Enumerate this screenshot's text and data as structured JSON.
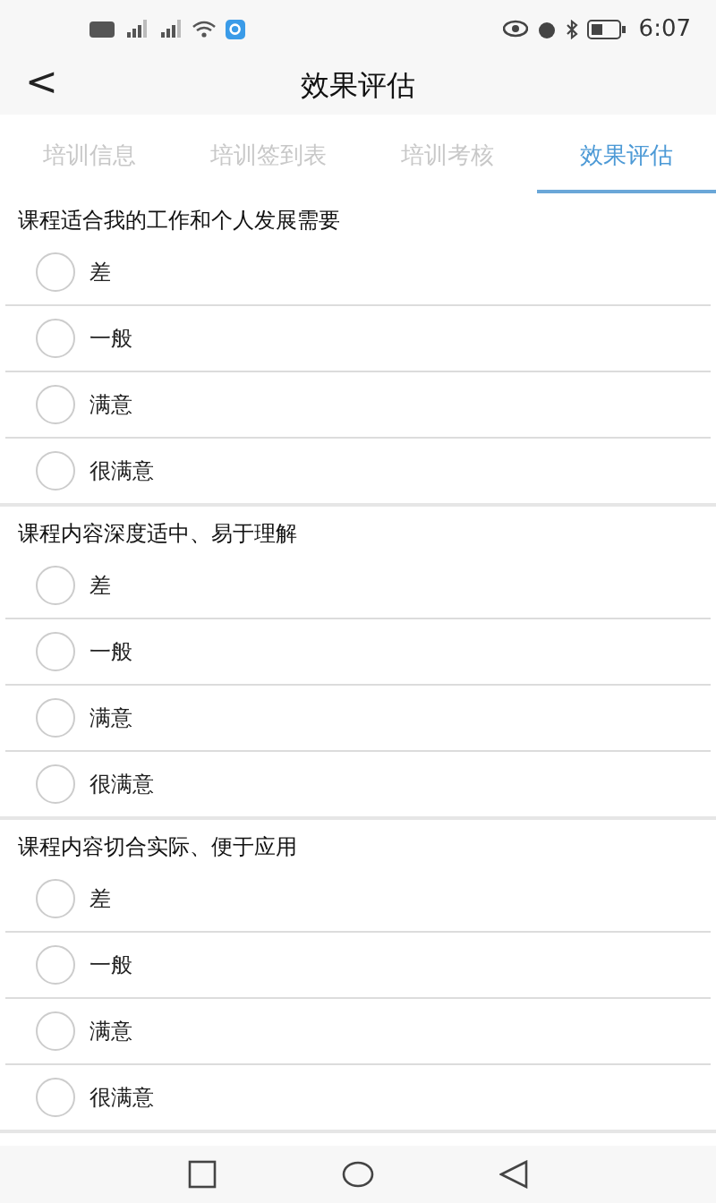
{
  "status_bar": {
    "time": "6:07"
  },
  "header": {
    "back": "<",
    "title": "效果评估"
  },
  "tabs": [
    {
      "label": "培训信息",
      "selected": false
    },
    {
      "label": "培训签到表",
      "selected": false
    },
    {
      "label": "培训考核",
      "selected": false
    },
    {
      "label": "效果评估",
      "selected": true
    }
  ],
  "questions": [
    {
      "title": "课程适合我的工作和个人发展需要",
      "options": [
        {
          "label": "差",
          "selected": false
        },
        {
          "label": "一般",
          "selected": false
        },
        {
          "label": "满意",
          "selected": false
        },
        {
          "label": "很满意",
          "selected": false
        }
      ]
    },
    {
      "title": "课程内容深度适中、易于理解",
      "options": [
        {
          "label": "差",
          "selected": false
        },
        {
          "label": "一般",
          "selected": false
        },
        {
          "label": "满意",
          "selected": false
        },
        {
          "label": "很满意",
          "selected": false
        }
      ]
    },
    {
      "title": "课程内容切合实际、便于应用",
      "options": [
        {
          "label": "差",
          "selected": false
        },
        {
          "label": "一般",
          "selected": false
        },
        {
          "label": "满意",
          "selected": false
        },
        {
          "label": "很满意",
          "selected": false
        }
      ]
    }
  ]
}
